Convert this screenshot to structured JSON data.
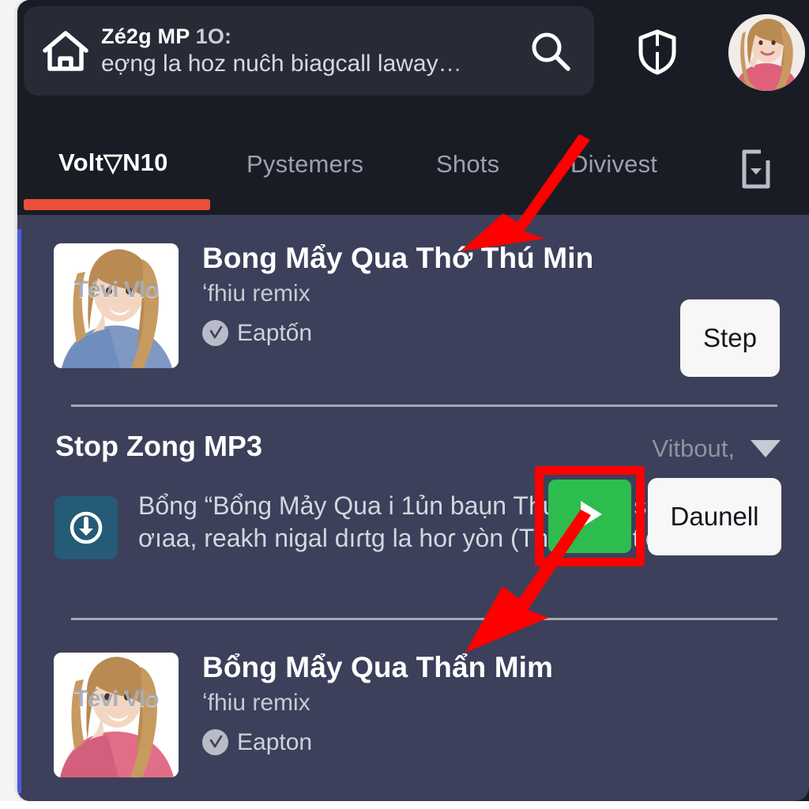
{
  "header": {
    "home_icon": "home-icon",
    "search": {
      "title_main": "Zé2g MP",
      "title_dim": " 1O:",
      "query": "eợng la hoz nuĉh biagcall laway…",
      "search_icon": "search-icon"
    },
    "shield_icon": "shield-icon",
    "avatar": "user-avatar"
  },
  "tabs": {
    "items": [
      {
        "label": "Volt▽N10",
        "active": true
      },
      {
        "label": "Pystemers",
        "active": false
      },
      {
        "label": "Shots",
        "active": false
      },
      {
        "label": "Divivest",
        "active": false
      }
    ],
    "download_icon": "download-to-device-icon",
    "active_indicator_color": "#e8503a"
  },
  "content": {
    "songs": [
      {
        "title": "Bong Mẩy Qua Thớ Thú Min",
        "subtitle": "ʻfhiu remix",
        "channel": "Eaptốn",
        "channel_badge_icon": "verified-check-icon",
        "thumb_watermark": "Tévi      Vlo",
        "action_label": "Step"
      },
      {
        "title": "Bổng Mẩy Qua Thẩn Mim",
        "subtitle": "ʻfhiu remix",
        "channel": "Eapton",
        "channel_badge_icon": "verified-check-icon",
        "thumb_watermark": "Tévi      Vlo",
        "action_label": "Daunell",
        "play_icon": "play-icon"
      }
    ],
    "section": {
      "title": "Stop Zong MP3",
      "right_label": "Vitbout,",
      "caret_icon": "chevron-down-icon",
      "download_icon": "download-circle-icon",
      "description": "Bổng “Bổng Mảy Qua i 1ủn baụn Thu Minh” siopnol ơıaa, reakh nigal dıɾtg la hoɾ yòn (Thoɾ shat tio))."
    }
  },
  "annotations": {
    "arrow_1": "red-arrow-pointing-to-song-title",
    "arrow_2": "red-arrow-pointing-to-second-song-title",
    "highlight_box": "red-highlight-around-play-button",
    "arrow_color": "#ff0000",
    "highlight_color": "#ff0000",
    "play_button_color": "#2dbd4e"
  }
}
